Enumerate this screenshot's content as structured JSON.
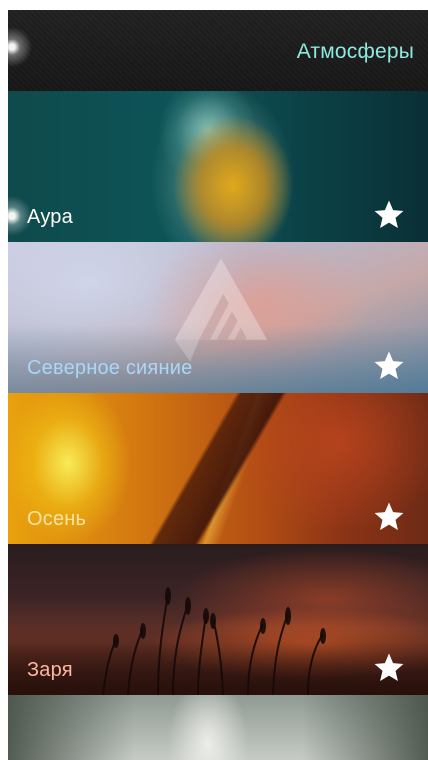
{
  "header": {
    "title": "Атмосферы"
  },
  "cards": [
    {
      "label": "Аура",
      "favorite_icon": "star-icon"
    },
    {
      "label": "Северное сияние",
      "favorite_icon": "star-icon"
    },
    {
      "label": "Осень",
      "favorite_icon": "star-icon"
    },
    {
      "label": "Заря",
      "favorite_icon": "star-icon"
    }
  ],
  "colors": {
    "header_title": "#8ee8e0",
    "aura_label": "#ffffff",
    "north_label": "#a8d8f8",
    "autumn_label": "#f8e3a0",
    "dawn_label": "#ffb6a0",
    "star": "#ffffff"
  }
}
